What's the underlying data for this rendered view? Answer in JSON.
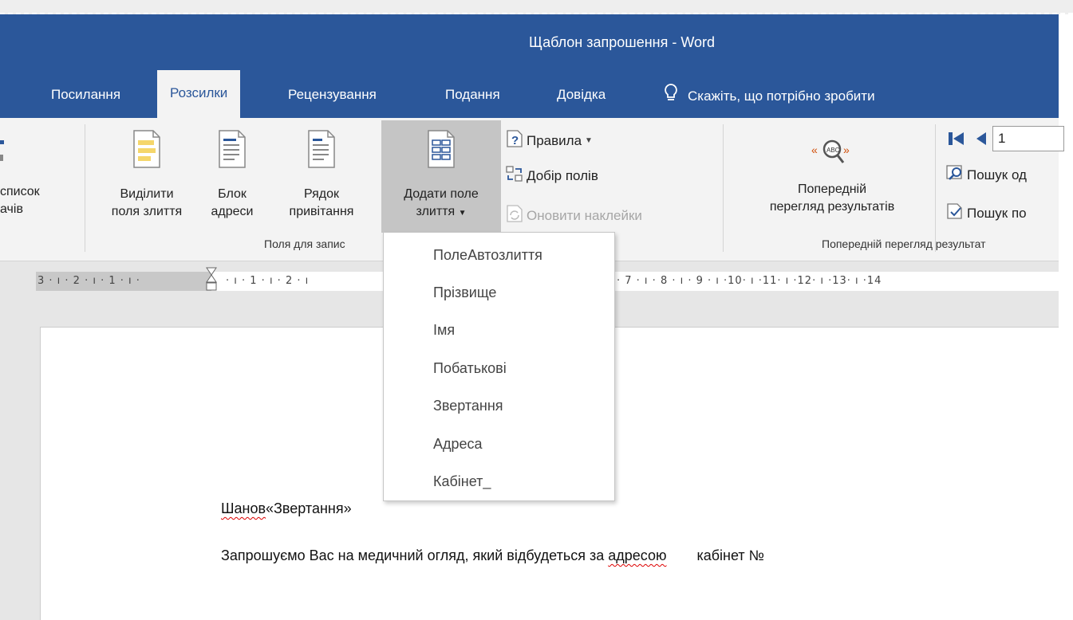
{
  "window": {
    "title": "Щаблон запрошення  -  Word"
  },
  "tabs": [
    {
      "label": "Посилання"
    },
    {
      "label": "Розсилки",
      "active": true
    },
    {
      "label": "Рецензування"
    },
    {
      "label": "Подання"
    },
    {
      "label": "Довідка"
    }
  ],
  "tell_me": {
    "text": "Скажіть, що потрібно зробити",
    "icon": "lightbulb-icon"
  },
  "ribbon": {
    "recipients_partial": {
      "line1": "список",
      "line2": "ачів"
    },
    "highlight_fields": {
      "line1": "Виділити",
      "line2": "поля злиття"
    },
    "address_block": {
      "line1": "Блок",
      "line2": "адреси"
    },
    "greeting_line": {
      "line1": "Рядок",
      "line2": "привітання"
    },
    "insert_merge_field": {
      "line1": "Додати поле",
      "line2": "злиття"
    },
    "rules": "Правила",
    "match_fields": "Добір полів",
    "update_labels": "Оновити наклейки",
    "group_write_insert": "Поля для запис",
    "preview_results": {
      "line1": "Попередній",
      "line2": "перегляд результатів"
    },
    "group_preview": "Попередній перегляд результат",
    "find_recipient": "Пошук од",
    "check_errors": "Пошук по",
    "record_number": "1"
  },
  "ruler": {
    "left_text": "3 · ı · 2 · ı · 1 · ı ·",
    "mid_text": "· ı · 1 · ı · 2 · ı",
    "right_text": "· 7 · ı · 8 · ı · 9 · ı ·10· ı ·11· ı ·12· ı ·13· ı ·14"
  },
  "merge_fields_menu": [
    "ПолеАвтозлиття",
    "Прізвище",
    "Імя",
    "Побатькові",
    "Звертання",
    "Адреса",
    "Кабінет_"
  ],
  "document": {
    "greeting_word": "Шанов",
    "greeting_field": "«Звертання»",
    "body_before": "Запрошуємо Вас на медичний огляд, який відбудеться за ",
    "body_underlined": "адресою",
    "body_after": "кабінет №"
  },
  "colors": {
    "word_blue": "#2b579a",
    "ribbon_bg": "#f3f3f3",
    "pressed": "#c5c5c5"
  }
}
